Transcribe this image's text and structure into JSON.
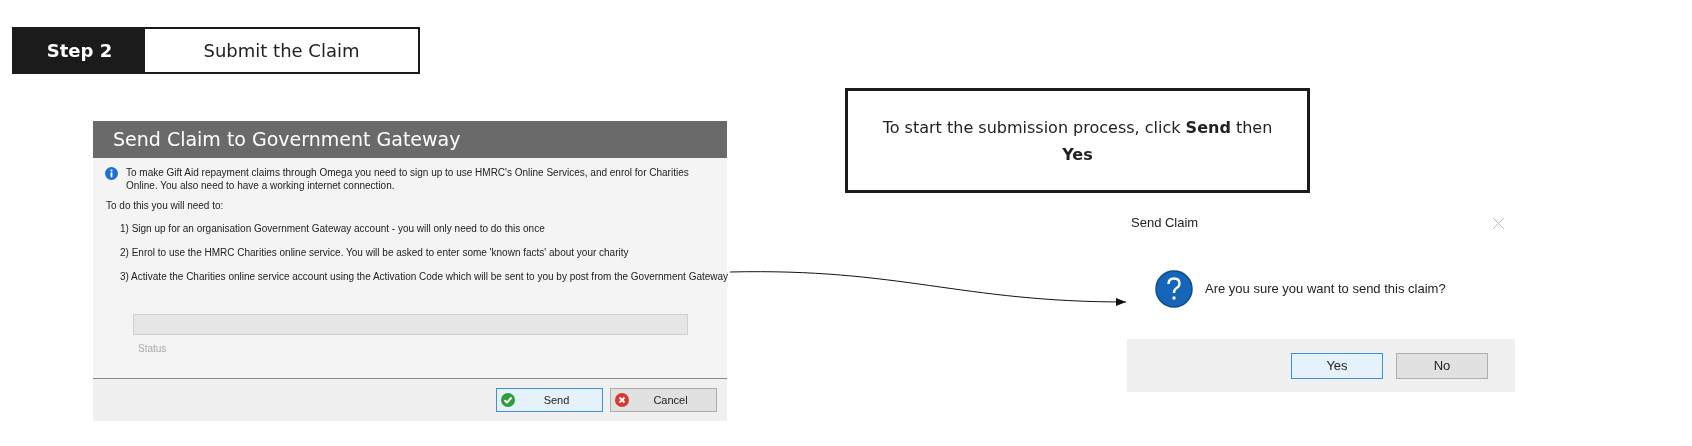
{
  "step": {
    "label": "Step 2",
    "title": "Submit the Claim"
  },
  "gateway_dialog": {
    "title": "Send Claim to Government Gateway",
    "info": "To make Gift Aid repayment claims through Omega you need to sign up to use HMRC's Online Services, and enrol for Charities Online. You also need to have a working internet connection.",
    "intro": "To do this you will need to:",
    "steps": [
      "1) Sign up for an organisation Government Gateway account - you will only need to do this once",
      "2) Enrol to use the HMRC Charities online service. You will be asked to enter some 'known facts' about your charity",
      "3) Activate the Charities online service account using the Activation Code which will be sent to you by post from the Government Gateway"
    ],
    "status_label": "Status",
    "buttons": [
      {
        "label": "Send",
        "kind": "ok",
        "default": true
      },
      {
        "label": "Cancel",
        "kind": "cancel",
        "default": false
      }
    ]
  },
  "callout": "To start the submission process, click **Send** then **Yes**",
  "confirm_dialog": {
    "title": "Send Claim",
    "message": "Are you sure you want to send this claim?",
    "buttons": [
      {
        "label": "Yes",
        "default": true
      },
      {
        "label": "No",
        "default": false
      }
    ]
  }
}
